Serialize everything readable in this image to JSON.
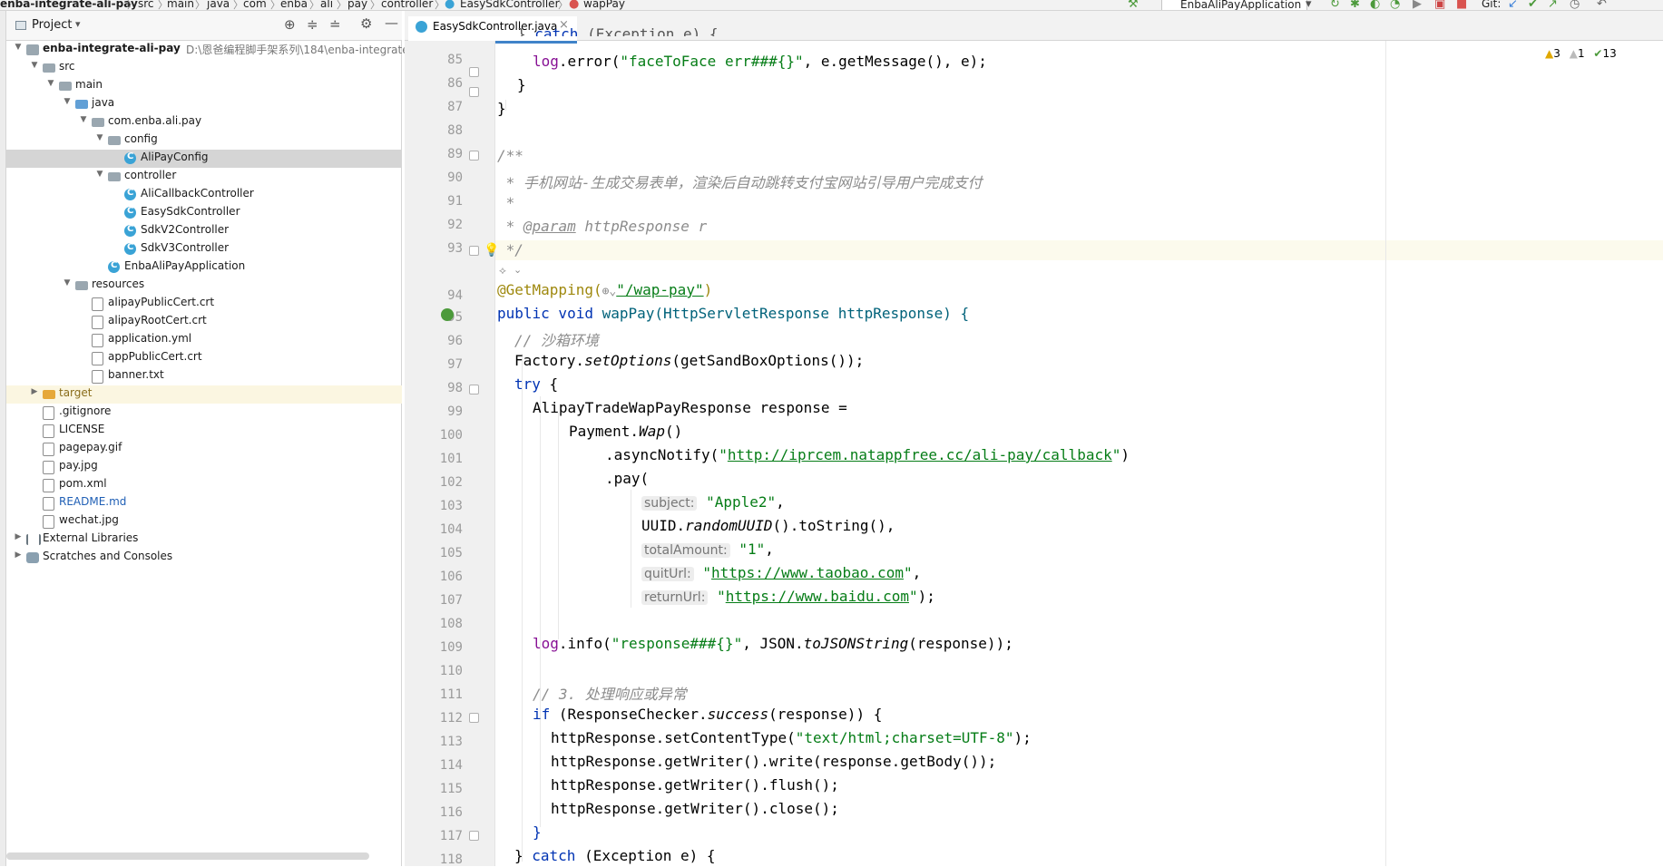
{
  "breadcrumbs": [
    "enba-integrate-ali-pay",
    "src",
    "main",
    "java",
    "com",
    "enba",
    "ali",
    "pay",
    "controller",
    "EasySdkController",
    "wapPay"
  ],
  "toolbar": {
    "run_config": "EnbaAliPayApplication",
    "git_label": "Git:"
  },
  "inspections": {
    "warnings": "3",
    "weak_warnings": "1",
    "ok_count": "13"
  },
  "project_panel": {
    "title": "Project",
    "tree": [
      {
        "label": "enba-integrate-ali-pay",
        "path": "D:\\恩爸编程脚手架系列\\184\\enba-integrate-a",
        "icon": "module",
        "arrow": "down"
      },
      {
        "label": "src",
        "icon": "folder",
        "arrow": "down"
      },
      {
        "label": "main",
        "icon": "folder",
        "arrow": "down"
      },
      {
        "label": "java",
        "icon": "folder-blue",
        "arrow": "down"
      },
      {
        "label": "com.enba.ali.pay",
        "icon": "package",
        "arrow": "down"
      },
      {
        "label": "config",
        "icon": "package",
        "arrow": "down"
      },
      {
        "label": "AliPayConfig",
        "icon": "class"
      },
      {
        "label": "controller",
        "icon": "package",
        "arrow": "down"
      },
      {
        "label": "AliCallbackController",
        "icon": "class"
      },
      {
        "label": "EasySdkController",
        "icon": "class"
      },
      {
        "label": "SdkV2Controller",
        "icon": "class"
      },
      {
        "label": "SdkV3Controller",
        "icon": "class"
      },
      {
        "label": "EnbaAliPayApplication",
        "icon": "class"
      },
      {
        "label": "resources",
        "icon": "folder-res",
        "arrow": "down"
      },
      {
        "label": "alipayPublicCert.crt",
        "icon": "file"
      },
      {
        "label": "alipayRootCert.crt",
        "icon": "file"
      },
      {
        "label": "application.yml",
        "icon": "file"
      },
      {
        "label": "appPublicCert.crt",
        "icon": "file"
      },
      {
        "label": "banner.txt",
        "icon": "file"
      },
      {
        "label": "target",
        "icon": "folder-orange",
        "arrow": "right"
      },
      {
        "label": ".gitignore",
        "icon": "file"
      },
      {
        "label": "LICENSE",
        "icon": "file"
      },
      {
        "label": "pagepay.gif",
        "icon": "file"
      },
      {
        "label": "pay.jpg",
        "icon": "file"
      },
      {
        "label": "pom.xml",
        "icon": "file"
      },
      {
        "label": "README.md",
        "icon": "file"
      },
      {
        "label": "wechat.jpg",
        "icon": "file"
      },
      {
        "label": "External Libraries",
        "icon": "library",
        "arrow": "right"
      },
      {
        "label": "Scratches and Consoles",
        "icon": "scratch",
        "arrow": "right"
      }
    ]
  },
  "editor": {
    "tab": "EasySdkController.java",
    "line_numbers": [
      "85",
      "86",
      "87",
      "88",
      "89",
      "90",
      "91",
      "92",
      "93",
      "94",
      "95",
      "96",
      "97",
      "98",
      "99",
      "100",
      "101",
      "102",
      "103",
      "104",
      "105",
      "106",
      "107",
      "108",
      "109",
      "110",
      "111",
      "112",
      "113",
      "114",
      "115",
      "116",
      "117",
      "118"
    ],
    "text": {
      "l85_str": "\"faceToFace err###{}\"",
      "l85_rest": ", e.getMessage(), e);",
      "l89": "/**",
      "l90": " * 手机网站-生成交易表单，渲染后自动跳转支付宝网站引导用户完成支付",
      "l91": " *",
      "l92_star": " * ",
      "l92_tag": "@param",
      "l92_rest": " httpResponse r",
      "l93": " */",
      "l94_ann": "@GetMapping(",
      "l94_url": "\"/wap-pay\"",
      "l94_close": ")",
      "l95_sig": "wapPay(HttpServletResponse httpResponse) {",
      "l96": "// 沙箱环境",
      "l97_a": "Factory.",
      "l97_b": "setOptions",
      "l97_c": "(getSandBoxOptions());",
      "l98_kw": "try",
      "l99": "AlipayTradeWapPayResponse response =",
      "l100_a": "Payment.",
      "l100_b": "Wap",
      "l100_c": "()",
      "l101_a": ".asyncNotify(",
      "l101_url": "http://iprcem.natappfree.cc/ali-pay/callback",
      "l102": ".pay(",
      "l103_hint": "subject:",
      "l103_val": "\"Apple2\"",
      "l104_a": "UUID.",
      "l104_b": "randomUUID",
      "l104_c": "().toString(),",
      "l105_hint": "totalAmount:",
      "l105_val": "\"1\"",
      "l106_hint": "quitUrl:",
      "l106_url": "https://www.taobao.com",
      "l107_hint": "returnUrl:",
      "l107_url": "https://www.baidu.com",
      "l109_a": ".info(",
      "l109_str": "\"response###{}\"",
      "l109_b": ", JSON.",
      "l109_c": "toJSONString",
      "l109_d": "(response));",
      "l111": "// 3. 处理响应或异常",
      "l112_a": "(ResponseChecker.",
      "l112_b": "success",
      "l112_c": "(response)) {",
      "l113_a": "httpResponse.setContentType(",
      "l113_str": "\"text/html;charset=UTF-8\"",
      "l113_b": ");",
      "l114": "httpResponse.getWriter().write(response.getBody());",
      "l115": "httpResponse.getWriter().flush();",
      "l116": "httpResponse.getWriter().close();",
      "l117": "}",
      "l118_b": " (Exception e) {"
    }
  }
}
